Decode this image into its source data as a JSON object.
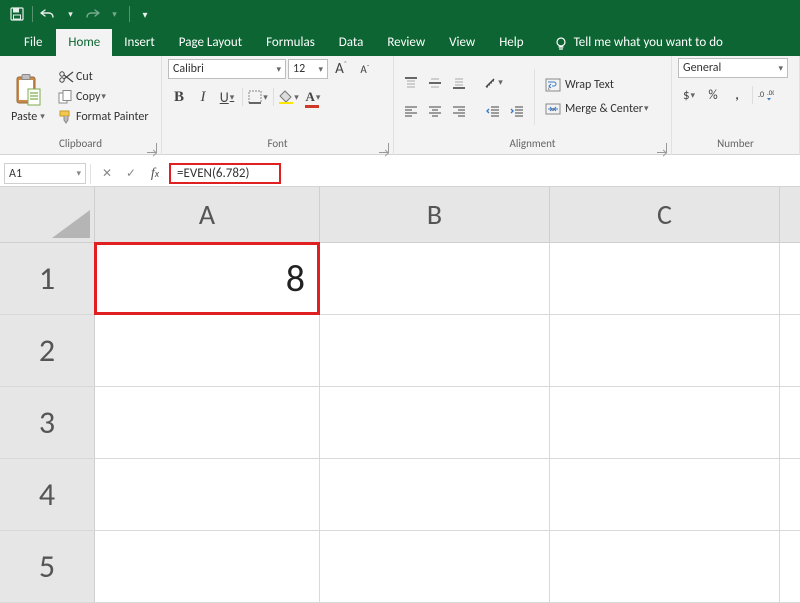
{
  "qat": {
    "save": "save",
    "undo": "undo",
    "redo": "redo"
  },
  "tabs": {
    "file": "File",
    "home": "Home",
    "insert": "Insert",
    "page_layout": "Page Layout",
    "formulas": "Formulas",
    "data": "Data",
    "review": "Review",
    "view": "View",
    "help": "Help",
    "tellme": "Tell me what you want to do"
  },
  "ribbon": {
    "clipboard": {
      "label": "Clipboard",
      "paste": "Paste",
      "cut": "Cut",
      "copy": "Copy",
      "format_painter": "Format Painter"
    },
    "font": {
      "label": "Font",
      "name": "Calibri",
      "size": "12",
      "grow": "A",
      "shrink": "A",
      "bold": "B",
      "italic": "I",
      "underline": "U"
    },
    "alignment": {
      "label": "Alignment",
      "wrap": "Wrap Text",
      "merge": "Merge & Center"
    },
    "number": {
      "label": "Number",
      "format": "General",
      "currency": "$",
      "percent": "%",
      "comma": ","
    }
  },
  "fbar": {
    "name": "A1",
    "formula": "=EVEN(6.782)"
  },
  "grid": {
    "cols": [
      "A",
      "B",
      "C"
    ],
    "rows": [
      "1",
      "2",
      "3",
      "4",
      "5"
    ],
    "cells": {
      "A1": "8"
    },
    "selected": "A1"
  }
}
